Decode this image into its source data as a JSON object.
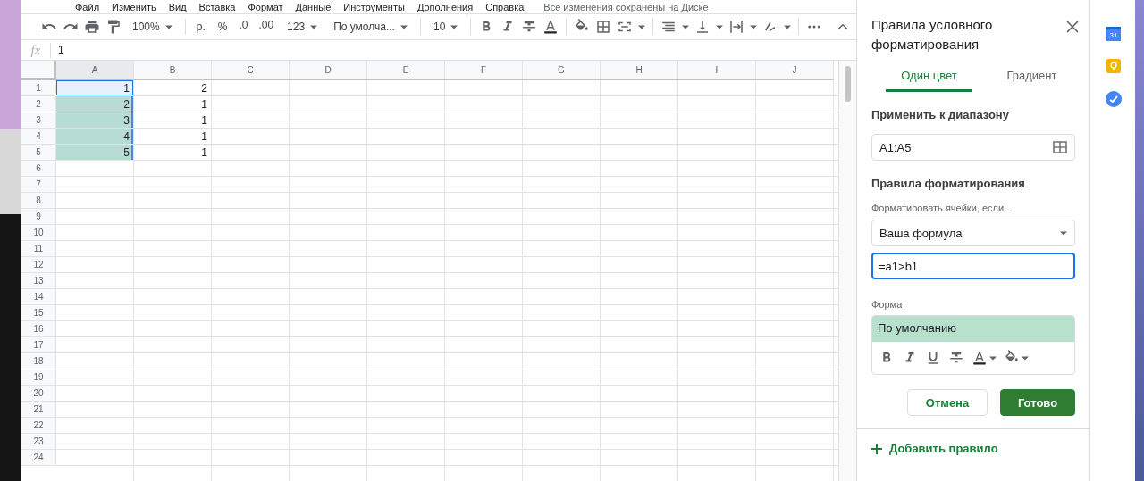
{
  "menu_bar": {
    "items": [
      "Файл",
      "Изменить",
      "Вид",
      "Вставка",
      "Формат",
      "Данные",
      "Инструменты",
      "Дополнения",
      "Справка"
    ],
    "save_status": "Все изменения сохранены на Диске"
  },
  "toolbar": [
    {
      "kind": "undo"
    },
    {
      "kind": "redo"
    },
    {
      "kind": "print"
    },
    {
      "kind": "paint-format"
    },
    {
      "kind": "dropdown",
      "text": "100%"
    },
    {
      "kind": "sep"
    },
    {
      "kind": "text",
      "text": "р."
    },
    {
      "kind": "text",
      "text": "%"
    },
    {
      "kind": "decimal-less",
      "text": ".0"
    },
    {
      "kind": "decimal-more",
      "text": ".00"
    },
    {
      "kind": "dropdown",
      "text": "123"
    },
    {
      "kind": "dropdown",
      "text": "По умолча..."
    },
    {
      "kind": "sep"
    },
    {
      "kind": "dropdown",
      "text": "10"
    },
    {
      "kind": "sep"
    },
    {
      "kind": "bold"
    },
    {
      "kind": "italic"
    },
    {
      "kind": "strike"
    },
    {
      "kind": "text-color"
    },
    {
      "kind": "sep"
    },
    {
      "kind": "fill"
    },
    {
      "kind": "borders"
    },
    {
      "kind": "merge"
    },
    {
      "kind": "sep"
    },
    {
      "kind": "halign"
    },
    {
      "kind": "valign"
    },
    {
      "kind": "wrap"
    },
    {
      "kind": "rotate"
    },
    {
      "kind": "sep"
    },
    {
      "kind": "more"
    }
  ],
  "formula_bar": {
    "label": "fx",
    "value": "1"
  },
  "sheet": {
    "columns": [
      "A",
      "B",
      "C",
      "D",
      "E",
      "F",
      "G",
      "H",
      "I",
      "J"
    ],
    "rows": [
      {
        "number": "1",
        "cells": [
          {
            "text": "1",
            "selected": true,
            "highlighted": false
          },
          {
            "text": "2",
            "selected": false,
            "highlighted": false
          }
        ]
      },
      {
        "number": "2",
        "cells": [
          {
            "text": "2",
            "selected": false,
            "highlighted": true
          },
          {
            "text": "1",
            "selected": false,
            "highlighted": false
          }
        ]
      },
      {
        "number": "3",
        "cells": [
          {
            "text": "3",
            "selected": false,
            "highlighted": true
          },
          {
            "text": "1",
            "selected": false,
            "highlighted": false
          }
        ]
      },
      {
        "number": "4",
        "cells": [
          {
            "text": "4",
            "selected": false,
            "highlighted": true
          },
          {
            "text": "1",
            "selected": false,
            "highlighted": false
          }
        ]
      },
      {
        "number": "5",
        "cells": [
          {
            "text": "5",
            "selected": false,
            "highlighted": true
          },
          {
            "text": "1",
            "selected": false,
            "highlighted": false
          }
        ]
      },
      {
        "number": "6",
        "cells": []
      },
      {
        "number": "7",
        "cells": []
      },
      {
        "number": "8",
        "cells": []
      },
      {
        "number": "9",
        "cells": []
      },
      {
        "number": "10",
        "cells": []
      },
      {
        "number": "11",
        "cells": []
      },
      {
        "number": "12",
        "cells": []
      },
      {
        "number": "13",
        "cells": []
      },
      {
        "number": "14",
        "cells": []
      },
      {
        "number": "15",
        "cells": []
      },
      {
        "number": "16",
        "cells": []
      },
      {
        "number": "17",
        "cells": []
      },
      {
        "number": "18",
        "cells": []
      },
      {
        "number": "19",
        "cells": []
      },
      {
        "number": "20",
        "cells": []
      },
      {
        "number": "21",
        "cells": []
      },
      {
        "number": "22",
        "cells": []
      },
      {
        "number": "23",
        "cells": []
      },
      {
        "number": "24",
        "cells": []
      }
    ]
  },
  "panel": {
    "title": "Правила условного форматирования",
    "tabs": [
      {
        "label": "Один цвет",
        "selected": true
      },
      {
        "label": "Градиент",
        "selected": false
      }
    ],
    "range_heading": "Применить к диапазону",
    "range_value": "A1:A5",
    "rules_heading": "Правила форматирования",
    "condition_label": "Форматировать ячейки, если…",
    "condition_value": "Ваша формула",
    "formula_value": "=a1>b1",
    "format_label": "Формат",
    "preview_text": "По умолчанию",
    "style_buttons": [
      {
        "kind": "bold"
      },
      {
        "kind": "italic"
      },
      {
        "kind": "underline"
      },
      {
        "kind": "strike"
      },
      {
        "kind": "text-color"
      },
      {
        "kind": "fill"
      }
    ],
    "cancel": "Отмена",
    "done": "Готово",
    "add_rule": "Добавить правило"
  },
  "side_panel": {
    "calendar_day": "31"
  }
}
